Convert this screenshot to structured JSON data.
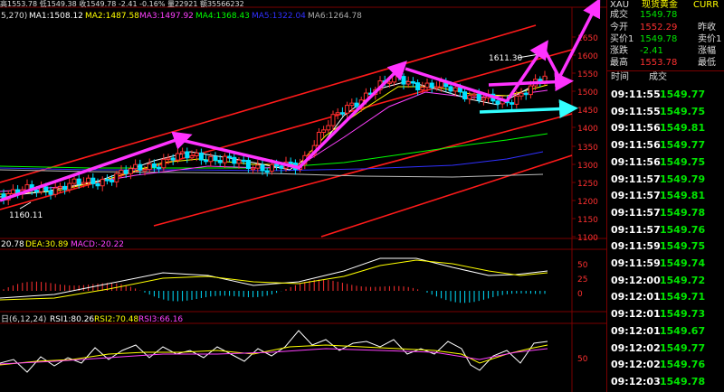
{
  "top_bar": {
    "price_summary": "高1553.78 低1549.38 收1549.78 -2.41 -0.16% 量22921 额35566232",
    "ma_label_partial": "5,270)",
    "ma1": "MA1:1508.12",
    "ma2": "MA2:1487.58",
    "ma3": "MA3:1497.92",
    "ma4": "MA4:1368.43",
    "ma5": "MA5:1322.04",
    "ma6": "MA6:1264.78"
  },
  "chart_annotations": {
    "high_label": "1611.30",
    "low_label": "1160.11"
  },
  "macd_bar": {
    "dif": "20.78",
    "dea": "DEA:30.89",
    "macd": "MACD:-20.22"
  },
  "rsi_bar": {
    "prefix": "日(6,12,24)",
    "rsi1": "RSI1:80.26",
    "rsi2": "RSI2:70.48",
    "rsi3": "RSI3:66.16"
  },
  "price_axis": [
    "1650",
    "1600",
    "1550",
    "1500",
    "1450",
    "1400",
    "1350",
    "1300",
    "1250",
    "1200",
    "1150",
    "1100"
  ],
  "macd_axis": [
    "50",
    "25",
    "0"
  ],
  "rsi_axis": [
    "50"
  ],
  "panel": {
    "symbol": "XAU",
    "name": "现货黄金",
    "curr": "CURR",
    "rows": [
      {
        "label": "成交",
        "value": "1549.78",
        "label2": ""
      },
      {
        "label": "今开",
        "value": "1552.29",
        "label2": "昨收"
      },
      {
        "label": "买价1",
        "value": "1549.78",
        "label2": "卖价1"
      },
      {
        "label": "涨跌",
        "value": "-2.41",
        "label2": "涨幅"
      },
      {
        "label": "最高",
        "value": "1553.78",
        "label2": "最低"
      }
    ],
    "ticks_header_time": "时间",
    "ticks_header_deal": "成交",
    "ticks": [
      {
        "time": "09:11:55",
        "price": "1549.77"
      },
      {
        "time": "09:11:55",
        "price": "1549.75"
      },
      {
        "time": "09:11:56",
        "price": "1549.81"
      },
      {
        "time": "09:11:56",
        "price": "1549.77"
      },
      {
        "time": "09:11:56",
        "price": "1549.75"
      },
      {
        "time": "09:11:57",
        "price": "1549.79"
      },
      {
        "time": "09:11:57",
        "price": "1549.81"
      },
      {
        "time": "09:11:57",
        "price": "1549.78"
      },
      {
        "time": "09:11:57",
        "price": "1549.76"
      },
      {
        "time": "09:11:59",
        "price": "1549.75"
      },
      {
        "time": "09:11:59",
        "price": "1549.74"
      },
      {
        "time": "09:12:00",
        "price": "1549.72"
      },
      {
        "time": "09:12:01",
        "price": "1549.71"
      },
      {
        "time": "09:12:01",
        "price": "1549.73"
      },
      {
        "time": "09:12:01",
        "price": "1549.67"
      },
      {
        "time": "09:12:02",
        "price": "1549.77"
      },
      {
        "time": "09:12:02",
        "price": "1549.76"
      },
      {
        "time": "09:12:03",
        "price": "1549.78"
      }
    ]
  },
  "colors": {
    "background": "#000000",
    "up_candle": "#ff3030",
    "down_candle": "#00e0ff",
    "channel": "#ff1a1a",
    "arrow": "#ff33ff",
    "cyan_arrow": "#33ffff",
    "tick_green": "#00e600"
  }
}
